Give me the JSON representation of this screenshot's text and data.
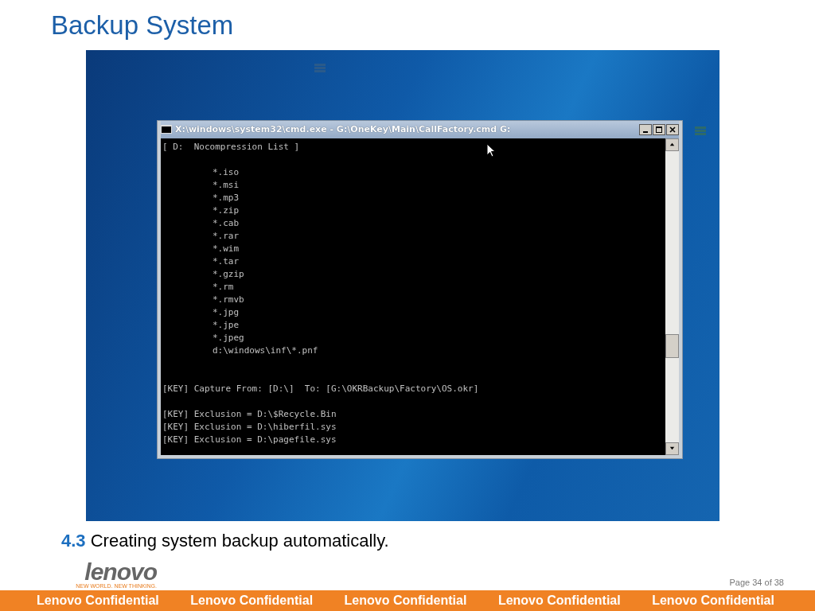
{
  "slide_title": "Backup System",
  "console_window": {
    "title": "X:\\windows\\system32\\cmd.exe - G:\\OneKey\\Main\\CallFactory.cmd  G:",
    "header": "[ D:  Nocompression List ]",
    "patterns": [
      "*.iso",
      "*.msi",
      "*.mp3",
      "*.zip",
      "*.cab",
      "*.rar",
      "*.wim",
      "*.tar",
      "*.gzip",
      "*.rm",
      "*.rmvb",
      "*.jpg",
      "*.jpe",
      "*.jpeg",
      "d:\\windows\\inf\\*.pnf"
    ],
    "capture_line": "[KEY] Capture From: [D:\\]  To: [G:\\OKRBackup\\Factory\\OS.okr]",
    "exclusions": [
      "[KEY] Exclusion = D:\\$Recycle.Bin",
      "[KEY] Exclusion = D:\\hiberfil.sys",
      "[KEY] Exclusion = D:\\pagefile.sys"
    ]
  },
  "caption": {
    "number": "4.3",
    "text": "Creating system backup automatically."
  },
  "logo": {
    "wordmark": "lenovo",
    "tagline": "NEW WORLD. NEW THINKING."
  },
  "page_number": "Page 34 of 38",
  "footer": [
    "Lenovo Confidential",
    "Lenovo Confidential",
    "Lenovo Confidential",
    "Lenovo Confidential",
    "Lenovo Confidential"
  ]
}
